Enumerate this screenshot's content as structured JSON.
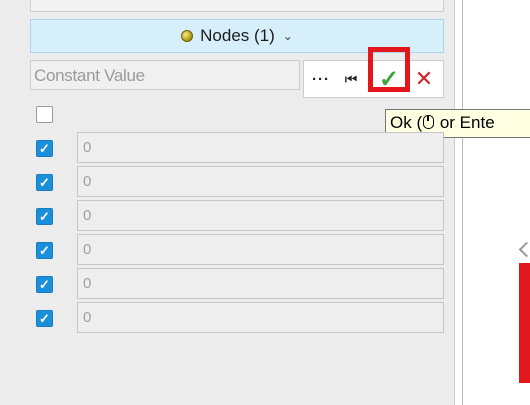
{
  "nodes_header": {
    "label": "Nodes (1)",
    "chevron": "⌄"
  },
  "constant_field": {
    "value": "Constant Value"
  },
  "toolbar": {
    "more_label": "···",
    "reset_label": "⏮",
    "ok_label": "✓",
    "cancel_label": "✕"
  },
  "tooltip": {
    "text_before": "Ok (",
    "text_after": " or Ente"
  },
  "rows": [
    {
      "checked": false,
      "value": ""
    },
    {
      "checked": true,
      "value": "0"
    },
    {
      "checked": true,
      "value": "0"
    },
    {
      "checked": true,
      "value": "0"
    },
    {
      "checked": true,
      "value": "0"
    },
    {
      "checked": true,
      "value": "0"
    },
    {
      "checked": true,
      "value": "0"
    }
  ],
  "colors": {
    "header_bg": "#d7eefb",
    "checkbox_checked": "#1a8fdc",
    "ok_green": "#3fa33f",
    "cancel_red": "#d0252a",
    "highlight_red": "#e3161b"
  },
  "icons": [
    "bullet-icon",
    "chevron-down-icon",
    "more-icon",
    "reset-icon",
    "checkmark-icon",
    "close-icon",
    "mouse-icon",
    "check-icon"
  ]
}
